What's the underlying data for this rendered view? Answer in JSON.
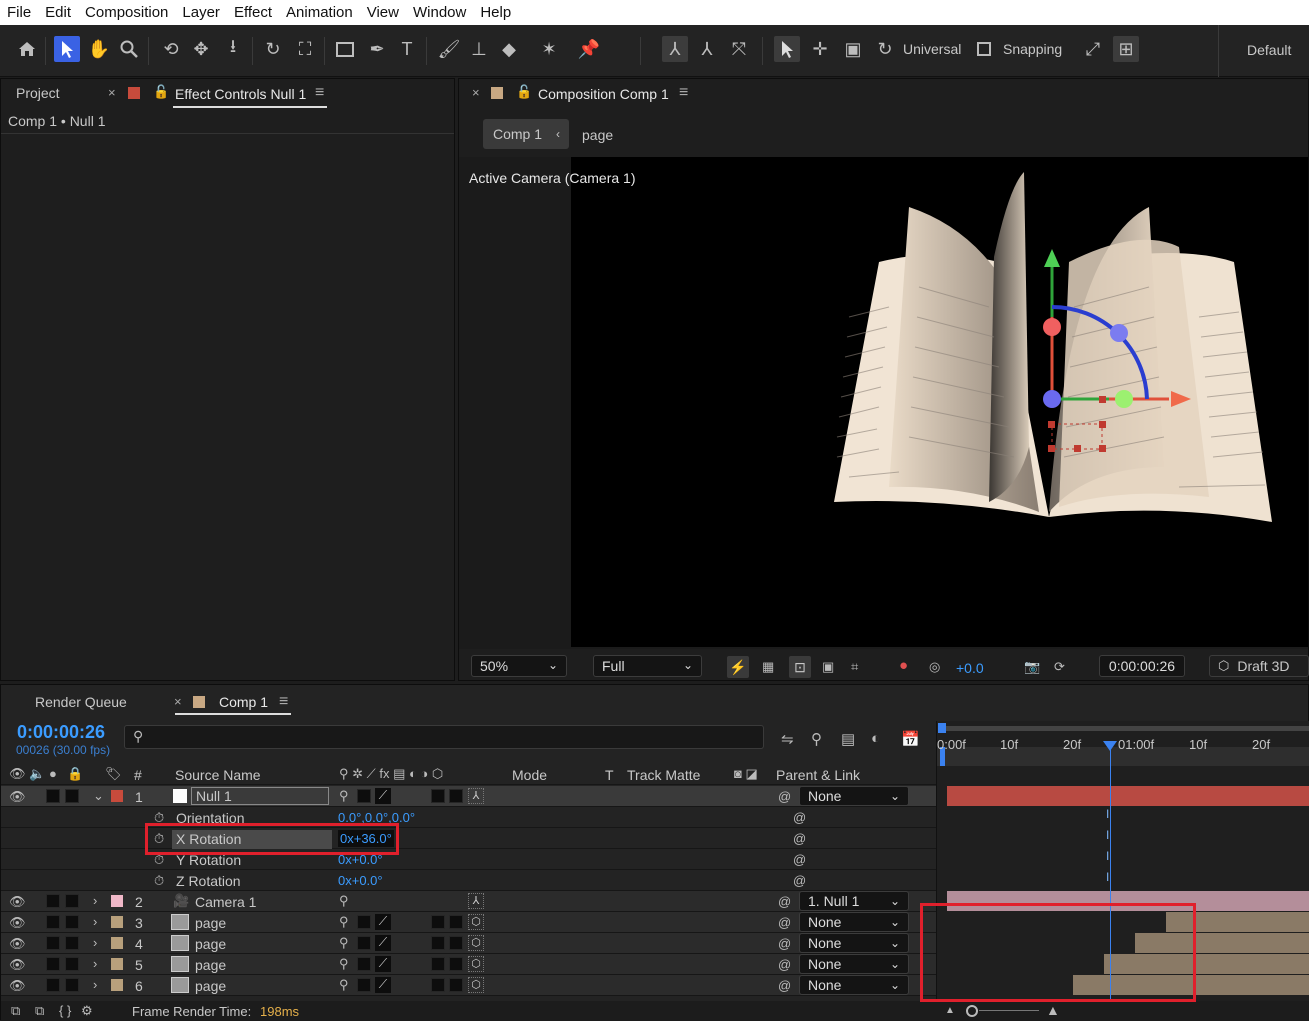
{
  "menu": [
    "File",
    "Edit",
    "Composition",
    "Layer",
    "Effect",
    "Animation",
    "View",
    "Window",
    "Help"
  ],
  "toolbar": {
    "universal": "Universal",
    "snapping": "Snapping",
    "workspace": "Default"
  },
  "left_panel": {
    "tab_project": "Project",
    "tab_effect": "Effect Controls Null 1",
    "breadcrumb": "Comp 1 • Null 1"
  },
  "comp_panel": {
    "tab": "Composition Comp 1",
    "crumb1": "Comp 1",
    "crumb2": "page",
    "view_label": "Active Camera (Camera 1)",
    "zoom": "50%",
    "resolution": "Full",
    "exposure": "+0.0",
    "timecode": "0:00:00:26",
    "renderer": "Draft 3D"
  },
  "timeline": {
    "tab_render": "Render Queue",
    "tab_comp": "Comp 1",
    "timecode": "0:00:00:26",
    "frame_info": "00026 (30.00 fps)",
    "search_placeholder": "",
    "headers": {
      "num": "#",
      "source": "Source Name",
      "mode": "Mode",
      "t": "T",
      "track_matte": "Track Matte",
      "parent": "Parent & Link"
    },
    "ruler": [
      "0:00f",
      "10f",
      "20f",
      "01:00f",
      "10f",
      "20f"
    ],
    "layers": [
      {
        "num": "1",
        "name": "Null 1",
        "color": "#c84b3c",
        "parent": "None"
      },
      {
        "num": "2",
        "name": "Camera 1",
        "color": "#f0b8c8",
        "parent": "1. Null 1"
      },
      {
        "num": "3",
        "name": "page",
        "color": "#b8a07c",
        "parent": "None"
      },
      {
        "num": "4",
        "name": "page",
        "color": "#b8a07c",
        "parent": "None"
      },
      {
        "num": "5",
        "name": "page",
        "color": "#b8a07c",
        "parent": "None"
      },
      {
        "num": "6",
        "name": "page",
        "color": "#b8a07c",
        "parent": "None"
      }
    ],
    "props": [
      {
        "name": "Orientation",
        "value": "0.0°,0.0°,0.0°"
      },
      {
        "name": "X Rotation",
        "value": "0x+36.0°"
      },
      {
        "name": "Y Rotation",
        "value": "0x+0.0°"
      },
      {
        "name": "Z Rotation",
        "value": "0x+0.0°"
      }
    ],
    "footer_label": "Frame Render Time:",
    "footer_value": "198ms"
  },
  "colors": {
    "accent": "#3a62e4",
    "highlight_box": "#e0202c",
    "timecode": "#3b9cff",
    "null_bar": "#b84a42",
    "camera_bar": "#b48e9a",
    "page_bar": "#8a7a66"
  }
}
